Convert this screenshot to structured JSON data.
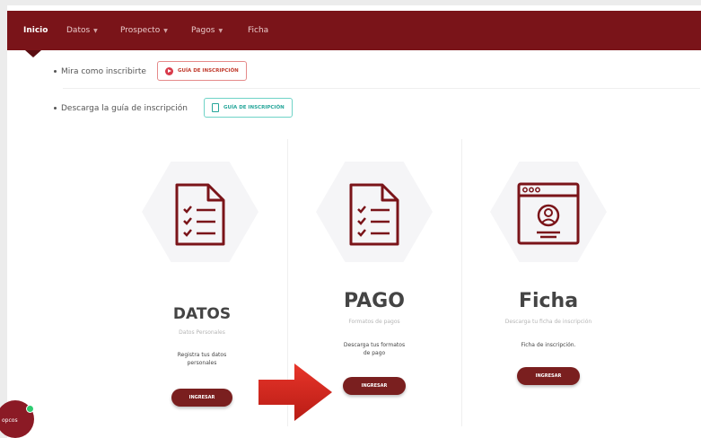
{
  "nav": {
    "items": [
      {
        "label": "Inicio"
      },
      {
        "label": "Datos"
      },
      {
        "label": "Prospecto"
      },
      {
        "label": "Pagos"
      },
      {
        "label": "Ficha"
      }
    ]
  },
  "guide": {
    "watch_text": "Mira como inscribirte",
    "watch_button": "GUÍA DE INSCRIPCIÓN",
    "download_text": "Descarga la guía de inscripción",
    "download_button": "GUÍA DE INSCRIPCIÓN"
  },
  "cards": [
    {
      "title": "DATOS",
      "subtitle": "Datos Personales",
      "desc_line1": "Registra tus datos",
      "desc_line2": "personales",
      "button": "INGRESAR"
    },
    {
      "title": "PAGO",
      "subtitle": "Formatos de pagos",
      "desc_line1": "Descarga tus formatos",
      "desc_line2": "de pago",
      "button": "INGRESAR"
    },
    {
      "title": "Ficha",
      "subtitle": "Descarga tu ficha de inscripción",
      "desc_line1": "Ficha de inscripción.",
      "button": "INGRESAR"
    }
  ],
  "help": {
    "label": "opcos"
  },
  "colors": {
    "brand": "#7a1419",
    "button": "#7a1f1f",
    "arrow": "#d9261c",
    "teal": "#26a69a",
    "online": "#2ecc71"
  }
}
